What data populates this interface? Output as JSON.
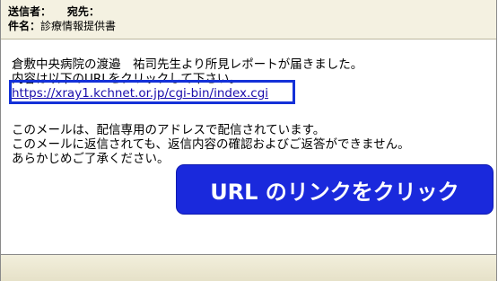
{
  "header": {
    "from_label": "送信者：",
    "to_label": "宛先：",
    "subject_label": "件名：",
    "subject_value": "診療情報提供書"
  },
  "body": {
    "line1": "倉敷中央病院の渡邉　祐司先生より所見レポートが届きました。",
    "line2": "内容は以下のURLをクリックして下さい。",
    "link": "https://xray1.kchnet.or.jp/cgi-bin/index.cgi",
    "notice_line1": "このメールは、配信専用のアドレスで配信されています。",
    "notice_line2": "このメールに返信されても、返信内容の確認およびご返答ができません。",
    "notice_line3": "あらかじめご了承ください。"
  },
  "callout": {
    "text": "URL のリンクをクリック"
  },
  "colors": {
    "header_bg": "#f4f1e1",
    "highlight": "#1431d8",
    "callout_bg": "#1a29dc",
    "link": "#1a0dab"
  }
}
